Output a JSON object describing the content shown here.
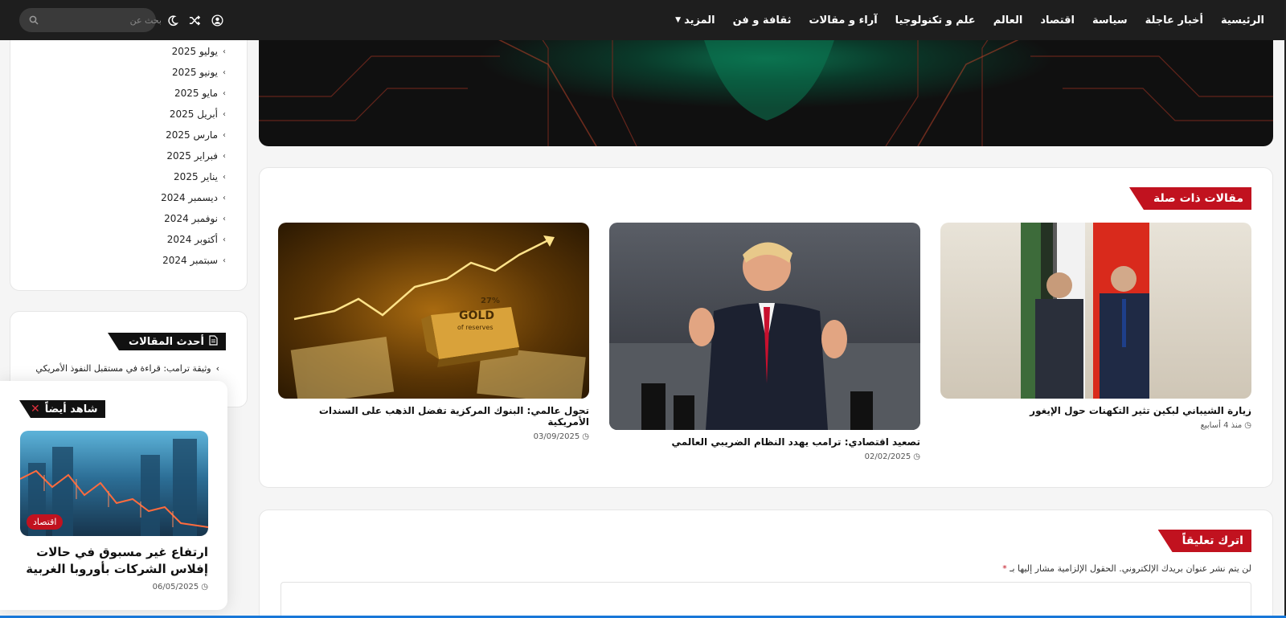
{
  "nav": {
    "items": [
      "الرئيسية",
      "أخبار عاجلة",
      "سياسة",
      "اقتصاد",
      "العالم",
      "علم و تكنولوجيا",
      "آراء و مقالات",
      "ثقافة و فن"
    ],
    "more_label": "المزيد",
    "search_placeholder": "بحث عن"
  },
  "icons": {
    "user": "user-icon",
    "shuffle": "shuffle-icon",
    "moon": "moon-icon",
    "search": "search-icon"
  },
  "archive": {
    "months": [
      "يوليو 2025",
      "يونيو 2025",
      "مايو 2025",
      "أبريل 2025",
      "مارس 2025",
      "فبراير 2025",
      "يناير 2025",
      "ديسمبر 2024",
      "نوفمبر 2024",
      "أكتوبر 2024",
      "سبتمبر 2024"
    ]
  },
  "recent": {
    "title": "أحدث المقالات",
    "first_item": "وثيقة ترامب: قراءة في مستقبل النفوذ الأمريكي"
  },
  "watch_also": {
    "title": "شاهد أيضاً",
    "badge": "اقتصاد",
    "headline": "ارتفاع غير مسبوق في حالات إفلاس الشركات بأوروبا الغربية",
    "date": "06/05/2025"
  },
  "related": {
    "title": "مقالات ذات صلة",
    "posts": [
      {
        "title": "زيارة الشيباني لبكين تثير التكهنات حول الإيغور",
        "date": "منذ 4 أسابيع"
      },
      {
        "title": "تصعيد اقتصادي: ترامب يهدد النظام الضريبي العالمي",
        "date": "02/02/2025"
      },
      {
        "title": "تحول عالمي: البنوك المركزية تفضل الذهب على السندات الأمريكية",
        "date": "03/09/2025"
      }
    ],
    "gold_label": "GOLD",
    "gold_pct": "27%",
    "gold_sub": "of reserves"
  },
  "comment": {
    "title": "اترك تعليقاً",
    "note": "لن يتم نشر عنوان بريدك الإلكتروني. الحقول الإلزامية مشار إليها بـ",
    "required_mark": "*"
  },
  "colors": {
    "accent": "#c1121f",
    "nav_bg": "#1e1e1e"
  }
}
